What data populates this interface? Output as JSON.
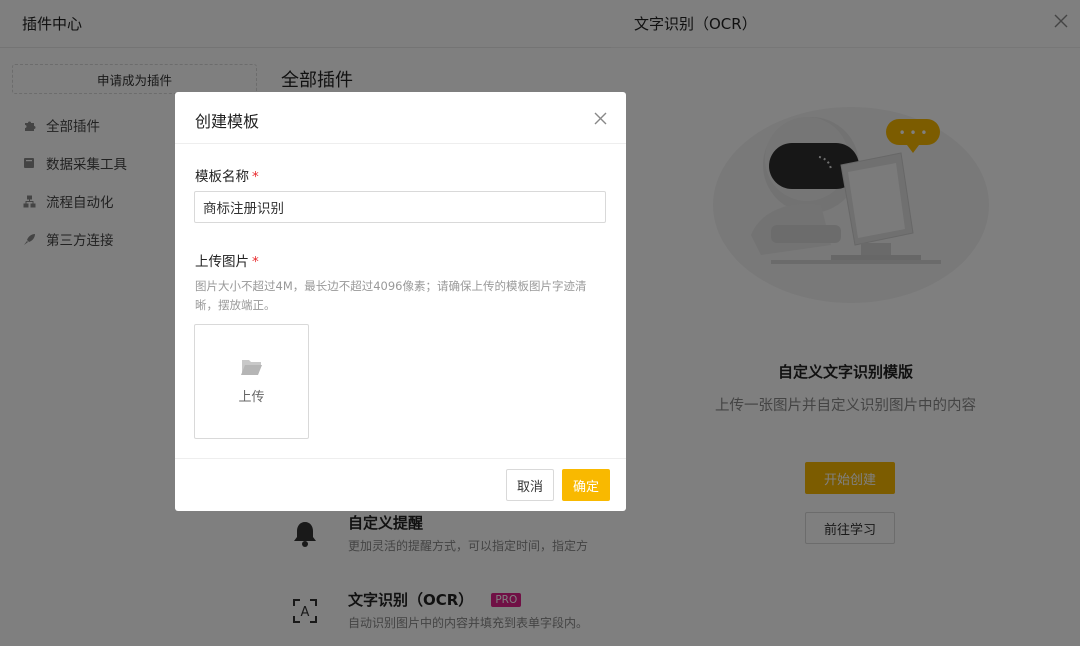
{
  "app": {
    "title": "插件中心"
  },
  "sidebar": {
    "apply_label": "申请成为插件",
    "items": [
      {
        "label": "全部插件",
        "icon": "puzzle-icon"
      },
      {
        "label": "数据采集工具",
        "icon": "book-icon"
      },
      {
        "label": "流程自动化",
        "icon": "flow-icon"
      },
      {
        "label": "第三方连接",
        "icon": "rocket-icon"
      }
    ]
  },
  "main": {
    "title": "全部插件",
    "plugins": [
      {
        "name": "自定义提醒",
        "desc": "更加灵活的提醒方式，可以指定时间，指定方",
        "icon": "bell-icon"
      },
      {
        "name": "文字识别（OCR）",
        "badge": "PRO",
        "desc": "自动识别图片中的内容并填充到表单字段内。",
        "icon": "ocr-icon"
      }
    ]
  },
  "drawer": {
    "title": "文字识别（OCR）",
    "heading": "自定义文字识别模版",
    "subtitle": "上传一张图片并自定义识别图片中的内容",
    "start_label": "开始创建",
    "learn_label": "前往学习",
    "speech_bubble_text": "• • •"
  },
  "modal": {
    "title": "创建模板",
    "name_label": "模板名称",
    "name_value": "商标注册识别",
    "upload_label": "上传图片",
    "required_mark": "*",
    "hint": "图片大小不超过4M，最长边不超过4096像素；请确保上传的模板图片字迹清晰，摆放端正。",
    "upload_button": "上传",
    "cancel_label": "取消",
    "ok_label": "确定"
  },
  "colors": {
    "accent": "#f9b900",
    "pro_badge": "#e0218a",
    "required": "#e8282b",
    "overlay": "rgba(0,0,0,0.5)"
  }
}
